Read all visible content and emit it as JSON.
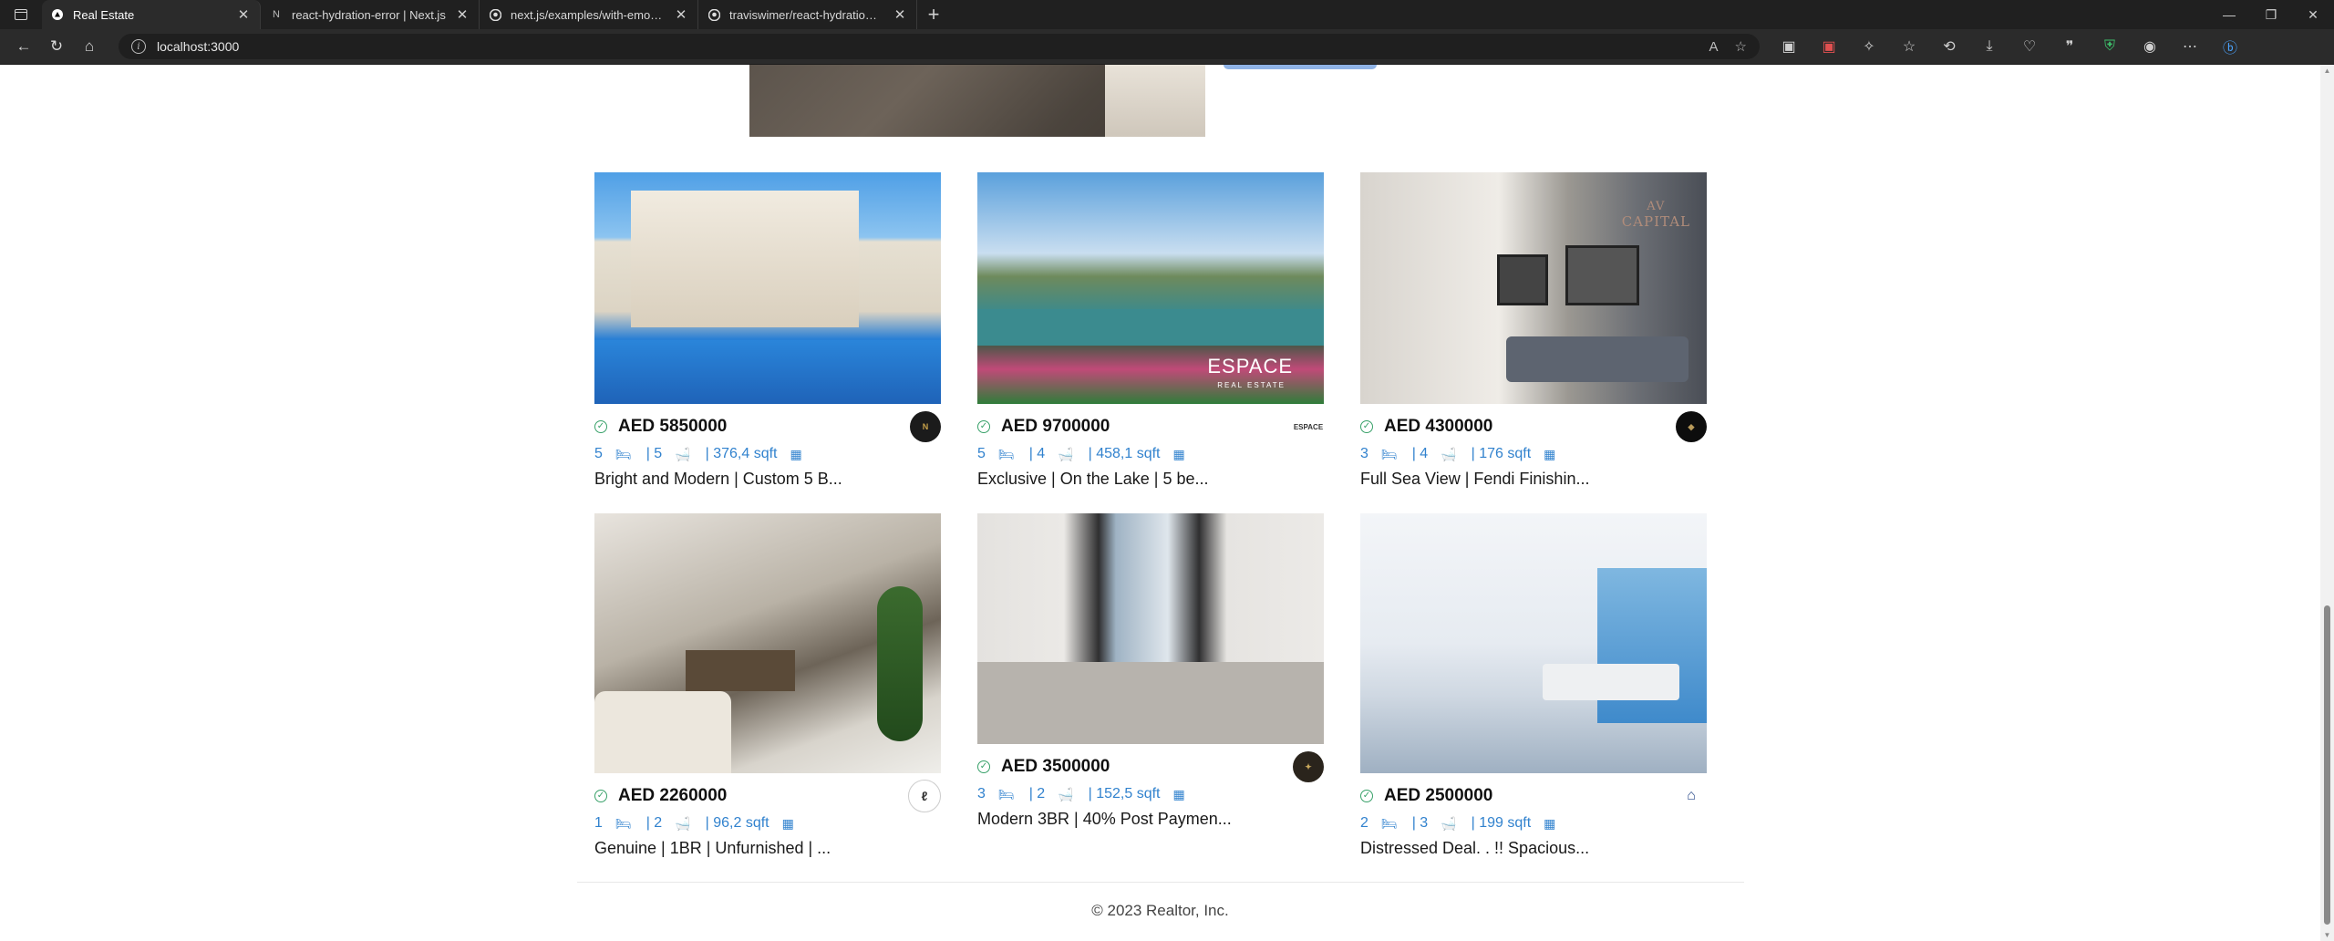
{
  "browser": {
    "tabs": [
      {
        "title": "Real Estate",
        "active": true,
        "icon": "triangle-icon"
      },
      {
        "title": "react-hydration-error | Next.js",
        "active": false,
        "icon": "nextjs-icon"
      },
      {
        "title": "next.js/examples/with-emotion a",
        "active": false,
        "icon": "github-icon"
      },
      {
        "title": "traviswimer/react-hydration-pro",
        "active": false,
        "icon": "github-icon"
      }
    ],
    "address": "localhost:3000"
  },
  "listings": [
    {
      "price": "AED 5850000",
      "rooms": "5",
      "baths": "| 5",
      "area": "| 376,4 sqft",
      "title": "Bright and Modern | Custom 5 B...",
      "agency_color": "#1b1b1b"
    },
    {
      "price": "AED 9700000",
      "rooms": "5",
      "baths": "| 4",
      "area": "| 458,1 sqft",
      "title": "Exclusive | On the Lake | 5 be...",
      "agency_text": "ESPACE",
      "agency_color": "#ffffff"
    },
    {
      "price": "AED 4300000",
      "rooms": "3",
      "baths": "| 4",
      "area": "| 176 sqft",
      "title": "Full Sea View | Fendi Finishin...",
      "agency_color": "#0d0d0d"
    },
    {
      "price": "AED 2260000",
      "rooms": "1",
      "baths": "| 2",
      "area": "| 96,2 sqft",
      "title": "Genuine | 1BR | Unfurnished | ...",
      "agency_color": "#ffffff"
    },
    {
      "price": "AED 3500000",
      "rooms": "3",
      "baths": "| 2",
      "area": "| 152,5 sqft",
      "title": "Modern 3BR | 40% Post Paymen...",
      "agency_color": "#2a241c"
    },
    {
      "price": "AED 2500000",
      "rooms": "2",
      "baths": "| 3",
      "area": "| 199 sqft",
      "title": "Distressed Deal. . !! Spacious...",
      "agency_color": "#ffffff"
    }
  ],
  "photo_text": {
    "espace": "ESPACE",
    "espace_sub": "REAL ESTATE",
    "capital": "CAPITAL",
    "capital_mark": "AV"
  },
  "footer": "© 2023 Realtor, Inc.",
  "colors": {
    "accent": "#3182ce",
    "verified": "#38a169"
  }
}
